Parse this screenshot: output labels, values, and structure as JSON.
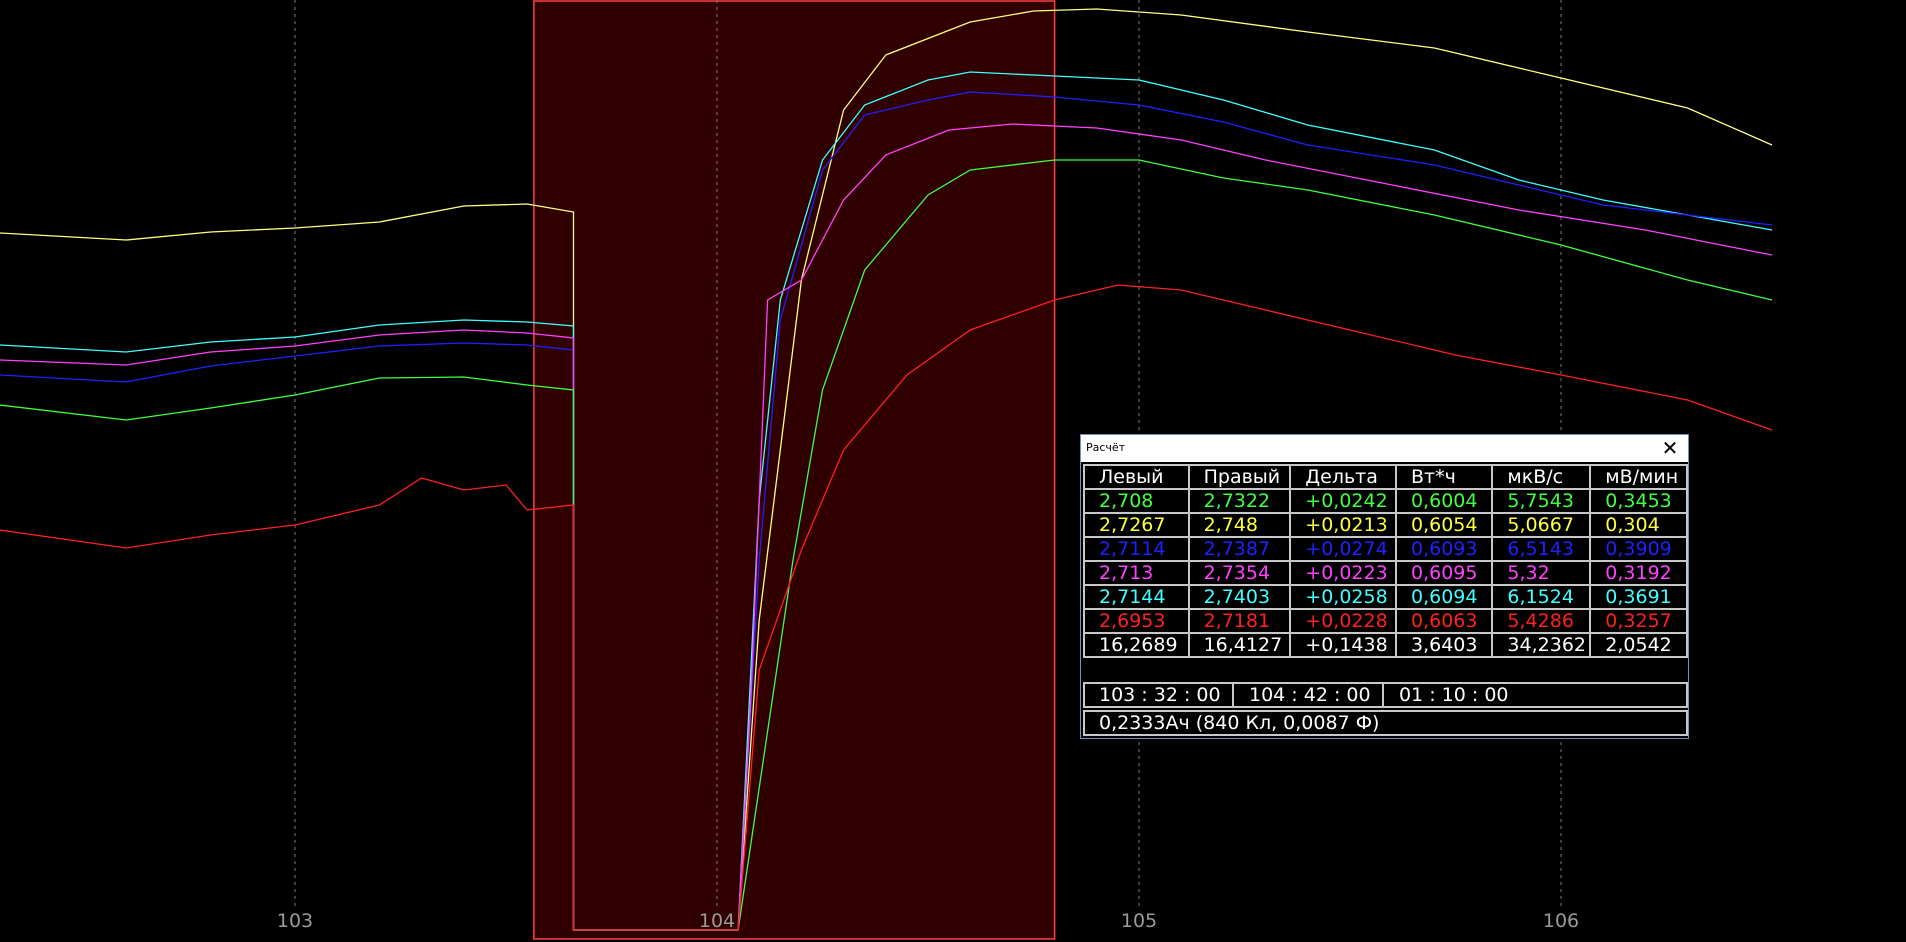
{
  "chart_data": {
    "type": "line",
    "x_ticks": [
      103,
      104,
      105,
      106
    ],
    "selection": {
      "x_start": 103.566,
      "x_end": 104.8,
      "color": "#300000",
      "border_color": "#ff4040"
    },
    "background": "#000000",
    "grid": true,
    "series": [
      {
        "color": "#ffff80",
        "points": [
          [
            102.3,
            233
          ],
          [
            102.6,
            240
          ],
          [
            102.8,
            232
          ],
          [
            103.0,
            228
          ],
          [
            103.2,
            222
          ],
          [
            103.4,
            206
          ],
          [
            103.55,
            204
          ],
          [
            103.66,
            212
          ],
          [
            103.66,
            930
          ],
          [
            104.05,
            930
          ],
          [
            104.1,
            620
          ],
          [
            104.2,
            280
          ],
          [
            104.3,
            110
          ],
          [
            104.4,
            55
          ],
          [
            104.6,
            22
          ],
          [
            104.75,
            11
          ],
          [
            104.9,
            9
          ],
          [
            105.1,
            15
          ],
          [
            105.4,
            32
          ],
          [
            105.7,
            48
          ],
          [
            106.0,
            78
          ],
          [
            106.3,
            108
          ],
          [
            106.5,
            145
          ]
        ]
      },
      {
        "color": "#40ffff",
        "points": [
          [
            102.3,
            345
          ],
          [
            102.6,
            352
          ],
          [
            102.8,
            342
          ],
          [
            103.0,
            337
          ],
          [
            103.2,
            325
          ],
          [
            103.4,
            320
          ],
          [
            103.55,
            322
          ],
          [
            103.66,
            326
          ],
          [
            103.66,
            930
          ],
          [
            104.05,
            930
          ],
          [
            104.1,
            500
          ],
          [
            104.15,
            300
          ],
          [
            104.25,
            160
          ],
          [
            104.35,
            105
          ],
          [
            104.5,
            80
          ],
          [
            104.6,
            72
          ],
          [
            104.8,
            76
          ],
          [
            105.0,
            80
          ],
          [
            105.2,
            100
          ],
          [
            105.4,
            125
          ],
          [
            105.7,
            150
          ],
          [
            105.9,
            180
          ],
          [
            106.1,
            200
          ],
          [
            106.5,
            230
          ]
        ]
      },
      {
        "color": "#2020ff",
        "points": [
          [
            102.3,
            375
          ],
          [
            102.6,
            382
          ],
          [
            102.8,
            366
          ],
          [
            103.0,
            356
          ],
          [
            103.2,
            346
          ],
          [
            103.4,
            343
          ],
          [
            103.55,
            345
          ],
          [
            103.66,
            350
          ],
          [
            103.66,
            930
          ],
          [
            104.05,
            930
          ],
          [
            104.1,
            560
          ],
          [
            104.15,
            320
          ],
          [
            104.25,
            170
          ],
          [
            104.35,
            115
          ],
          [
            104.5,
            100
          ],
          [
            104.6,
            92
          ],
          [
            104.8,
            97
          ],
          [
            105.0,
            105
          ],
          [
            105.2,
            122
          ],
          [
            105.4,
            145
          ],
          [
            105.7,
            165
          ],
          [
            105.9,
            185
          ],
          [
            106.1,
            205
          ],
          [
            106.5,
            225
          ]
        ]
      },
      {
        "color": "#ff40ff",
        "points": [
          [
            102.3,
            360
          ],
          [
            102.6,
            365
          ],
          [
            102.8,
            352
          ],
          [
            103.0,
            346
          ],
          [
            103.2,
            335
          ],
          [
            103.4,
            330
          ],
          [
            103.55,
            333
          ],
          [
            103.66,
            338
          ],
          [
            103.66,
            930
          ],
          [
            104.05,
            930
          ],
          [
            104.08,
            700
          ],
          [
            104.12,
            300
          ],
          [
            104.2,
            280
          ],
          [
            104.3,
            200
          ],
          [
            104.4,
            155
          ],
          [
            104.55,
            130
          ],
          [
            104.7,
            124
          ],
          [
            104.9,
            128
          ],
          [
            105.1,
            140
          ],
          [
            105.3,
            160
          ],
          [
            105.6,
            185
          ],
          [
            105.9,
            210
          ],
          [
            106.2,
            230
          ],
          [
            106.5,
            255
          ]
        ]
      },
      {
        "color": "#40ff40",
        "points": [
          [
            102.3,
            405
          ],
          [
            102.6,
            420
          ],
          [
            102.8,
            408
          ],
          [
            103.0,
            395
          ],
          [
            103.2,
            378
          ],
          [
            103.4,
            377
          ],
          [
            103.55,
            385
          ],
          [
            103.66,
            390
          ],
          [
            103.66,
            930
          ],
          [
            104.05,
            930
          ],
          [
            104.18,
            560
          ],
          [
            104.25,
            390
          ],
          [
            104.35,
            270
          ],
          [
            104.5,
            195
          ],
          [
            104.6,
            170
          ],
          [
            104.8,
            160
          ],
          [
            105.0,
            160
          ],
          [
            105.2,
            178
          ],
          [
            105.4,
            190
          ],
          [
            105.7,
            215
          ],
          [
            106.0,
            245
          ],
          [
            106.3,
            280
          ],
          [
            106.5,
            300
          ]
        ]
      },
      {
        "color": "#ff2020",
        "points": [
          [
            102.3,
            530
          ],
          [
            102.6,
            548
          ],
          [
            102.8,
            535
          ],
          [
            103.0,
            525
          ],
          [
            103.2,
            505
          ],
          [
            103.3,
            478
          ],
          [
            103.4,
            490
          ],
          [
            103.5,
            485
          ],
          [
            103.55,
            510
          ],
          [
            103.66,
            505
          ],
          [
            103.66,
            930
          ],
          [
            104.05,
            930
          ],
          [
            104.1,
            670
          ],
          [
            104.2,
            550
          ],
          [
            104.3,
            450
          ],
          [
            104.45,
            375
          ],
          [
            104.6,
            330
          ],
          [
            104.8,
            300
          ],
          [
            104.95,
            285
          ],
          [
            105.1,
            290
          ],
          [
            105.3,
            310
          ],
          [
            105.5,
            330
          ],
          [
            105.75,
            355
          ],
          [
            106.0,
            375
          ],
          [
            106.3,
            400
          ],
          [
            106.5,
            430
          ]
        ]
      }
    ]
  },
  "dialog": {
    "title": "Расчёт",
    "headers": [
      "Левый",
      "Правый",
      "Дельта",
      "Вт*ч",
      "мкВ/с",
      "мВ/мин"
    ],
    "rows": [
      {
        "color": "#40ff40",
        "values": [
          "2,708",
          "2,7322",
          "+0,0242",
          "0,6004",
          "5,7543",
          "0,3453"
        ]
      },
      {
        "color": "#ffff40",
        "values": [
          "2,7267",
          "2,748",
          "+0,0213",
          "0,6054",
          "5,0667",
          "0,304"
        ]
      },
      {
        "color": "#2020ff",
        "values": [
          "2,7114",
          "2,7387",
          "+0,0274",
          "0,6093",
          "6,5143",
          "0,3909"
        ]
      },
      {
        "color": "#ff40ff",
        "values": [
          "2,713",
          "2,7354",
          "+0,0223",
          "0,6095",
          "5,32",
          "0,3192"
        ]
      },
      {
        "color": "#40ffff",
        "values": [
          "2,7144",
          "2,7403",
          "+0,0258",
          "0,6094",
          "6,1524",
          "0,3691"
        ]
      },
      {
        "color": "#ff2020",
        "values": [
          "2,6953",
          "2,7181",
          "+0,0228",
          "0,6063",
          "5,4286",
          "0,3257"
        ]
      },
      {
        "color": "#ffffff",
        "values": [
          "16,2689",
          "16,4127",
          "+0,1438",
          "3,6403",
          "34,2362",
          "2,0542"
        ]
      }
    ],
    "times": [
      "103 : 32 : 00",
      "104 : 42 : 00",
      "01 : 10 : 00"
    ],
    "charge": "0,2333Ач (840 Кл, 0,0087 Ф)"
  }
}
